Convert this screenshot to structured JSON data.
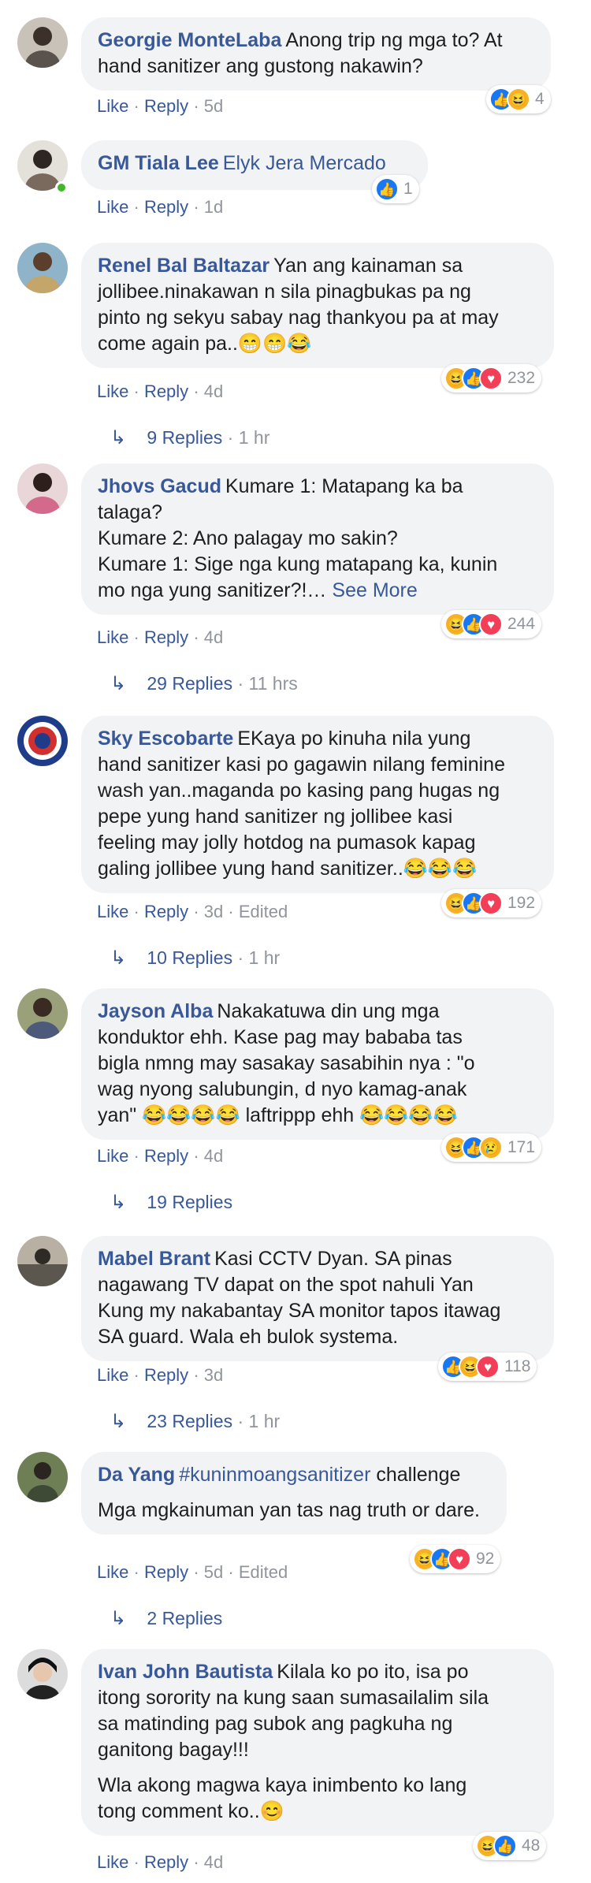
{
  "ui": {
    "like": "Like",
    "reply": "Reply",
    "sep": "·",
    "edited": "Edited",
    "see_more": "See More"
  },
  "comments": [
    {
      "name": "Georgie MonteLaba",
      "text": [
        "Anong trip ng mga to? At\nhand sanitizer ang gustong nakawin?"
      ],
      "time": "5d",
      "reactions": [
        "like",
        "haha"
      ],
      "count": "4"
    },
    {
      "name": "GM Tiala Lee",
      "mention": "Elyk Jera Mercado",
      "text": [
        ""
      ],
      "time": "1d",
      "reactions": [
        "like"
      ],
      "count": "1"
    },
    {
      "name": "Renel Bal Baltazar",
      "text": [
        "Yan ang kainaman sa\njollibee.ninakawan n sila pinagbukas pa ng\npinto ng sekyu sabay nag thankyou pa at may\ncome again pa..😁😁😂"
      ],
      "time": "4d",
      "reactions": [
        "haha",
        "like",
        "love"
      ],
      "count": "232",
      "replies": "9 Replies",
      "replies_time": "1 hr"
    },
    {
      "name": "Jhovs Gacud",
      "text": [
        "Kumare 1: Matapang ka ba\ntalaga?\nKumare 2: Ano palagay mo sakin?\nKumare 1: Sige nga kung matapang ka, kunin\nmo nga yung sanitizer?!…"
      ],
      "see_more": true,
      "time": "4d",
      "reactions": [
        "haha",
        "like",
        "love"
      ],
      "count": "244",
      "replies": "29 Replies",
      "replies_time": "11 hrs"
    },
    {
      "name": "Sky Escobarte",
      "text": [
        "EKaya po kinuha nila yung\nhand sanitizer kasi po gagawin nilang feminine\nwash yan..maganda po kasing pang hugas ng\npepe yung hand sanitizer ng jollibee kasi\nfeeling may jolly hotdog na pumasok kapag\ngaling jollibee yung hand sanitizer..😂😂😂"
      ],
      "time": "3d",
      "edited": true,
      "reactions": [
        "haha",
        "like",
        "love"
      ],
      "count": "192",
      "replies": "10 Replies",
      "replies_time": "1 hr"
    },
    {
      "name": "Jayson Alba",
      "text": [
        "Nakakatuwa din ung mga\nkonduktor ehh. Kase pag may bababa tas\nbigla nmng may sasakay sasabihin nya : \"o\nwag nyong salubungin, d nyo kamag-anak\nyan\" 😂😂😂😂 laftrippp ehh 😂😂😂😂"
      ],
      "time": "4d",
      "reactions": [
        "haha",
        "like",
        "sad"
      ],
      "count": "171",
      "replies": "19 Replies",
      "replies_time": ""
    },
    {
      "name": "Mabel Brant",
      "text": [
        "Kasi CCTV Dyan. SA pinas\nnagawang TV dapat on the spot nahuli Yan\nKung my nakabantay SA monitor tapos itawag\nSA guard. Wala eh bulok systema."
      ],
      "time": "3d",
      "reactions": [
        "like",
        "haha",
        "love"
      ],
      "count": "118",
      "replies": "23 Replies",
      "replies_time": "1 hr"
    },
    {
      "name": "Da Yang",
      "mention": "#kuninmoangsanitizer",
      "text": [
        "challenge",
        "Mga mgkainuman yan tas nag truth or dare."
      ],
      "time": "5d",
      "edited": true,
      "reactions": [
        "haha",
        "like",
        "love"
      ],
      "count": "92",
      "replies": "2 Replies",
      "replies_time": ""
    },
    {
      "name": "Ivan John Bautista",
      "text": [
        "Kilala ko po ito, isa po\nitong sorority na kung saan sumasailalim sila\nsa matinding pag subok ang pagkuha ng\nganitong bagay!!!",
        "Wla akong magwa kaya inimbento ko lang\ntong comment ko..😊"
      ],
      "time": "4d",
      "reactions": [
        "haha",
        "like"
      ],
      "count": "48"
    }
  ],
  "reaction_glyphs": {
    "like": "👍",
    "haha": "😆",
    "love": "♥",
    "sad": "😢"
  },
  "colors": {
    "link": "#385898",
    "bubble": "#f2f3f5",
    "meta": "#90949c"
  }
}
